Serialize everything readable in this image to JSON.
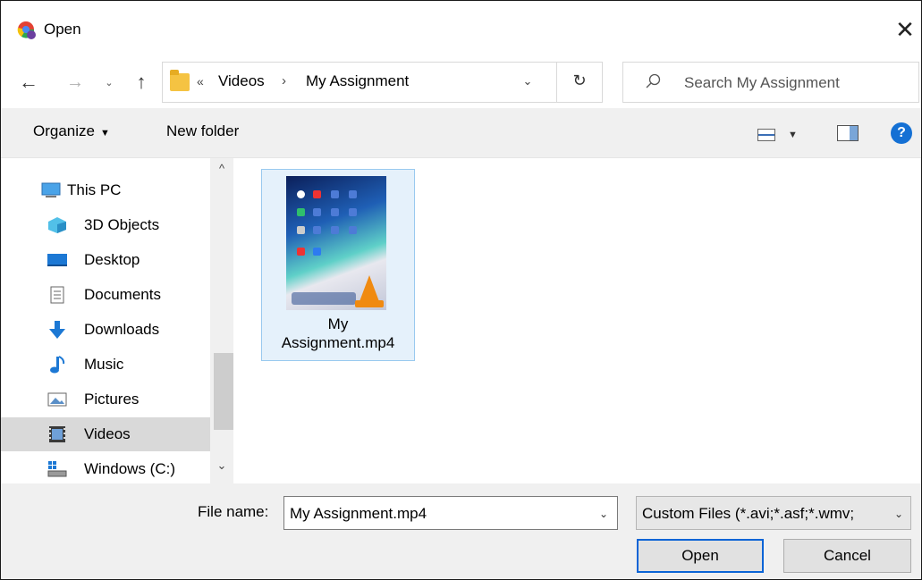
{
  "window": {
    "title": "Open",
    "close_glyph": "✕"
  },
  "nav": {
    "back_glyph": "←",
    "forward_glyph": "→",
    "recent_glyph": "⌄",
    "up_glyph": "↑"
  },
  "address": {
    "overflow_glyph": "«",
    "crumbs": [
      "Videos",
      "My Assignment"
    ],
    "separator": "›",
    "dropdown_glyph": "⌄",
    "refresh_glyph": "↻"
  },
  "search": {
    "placeholder": "Search My Assignment"
  },
  "toolbar": {
    "organize_label": "Organize",
    "caret_glyph": "▼",
    "new_folder_label": "New folder",
    "help_glyph": "?"
  },
  "sidebar": {
    "items": [
      {
        "label": "This PC",
        "icon": "this-pc-icon"
      },
      {
        "label": "3D Objects",
        "icon": "3d-objects-icon"
      },
      {
        "label": "Desktop",
        "icon": "desktop-icon"
      },
      {
        "label": "Documents",
        "icon": "documents-icon"
      },
      {
        "label": "Downloads",
        "icon": "downloads-icon"
      },
      {
        "label": "Music",
        "icon": "music-icon"
      },
      {
        "label": "Pictures",
        "icon": "pictures-icon"
      },
      {
        "label": "Videos",
        "icon": "videos-icon",
        "selected": true
      },
      {
        "label": "Windows (C:)",
        "icon": "drive-icon"
      }
    ],
    "scroll_up_glyph": "^",
    "scroll_down_glyph": "⌄"
  },
  "files": [
    {
      "name_line1": "My",
      "name_line2": "Assignment.mp4",
      "selected": true
    }
  ],
  "bottom": {
    "file_name_label": "File name:",
    "file_name_value": "My Assignment.mp4",
    "file_type_value": "Custom Files (*.avi;*.asf;*.wmv;",
    "dropdown_glyph": "⌄",
    "open_label": "Open",
    "cancel_label": "Cancel"
  },
  "colors": {
    "accent": "#0a64d6",
    "selected_tile_bg": "#e5f1fb",
    "selected_nav_bg": "#d9d9d9",
    "help_blue": "#1470d4"
  }
}
